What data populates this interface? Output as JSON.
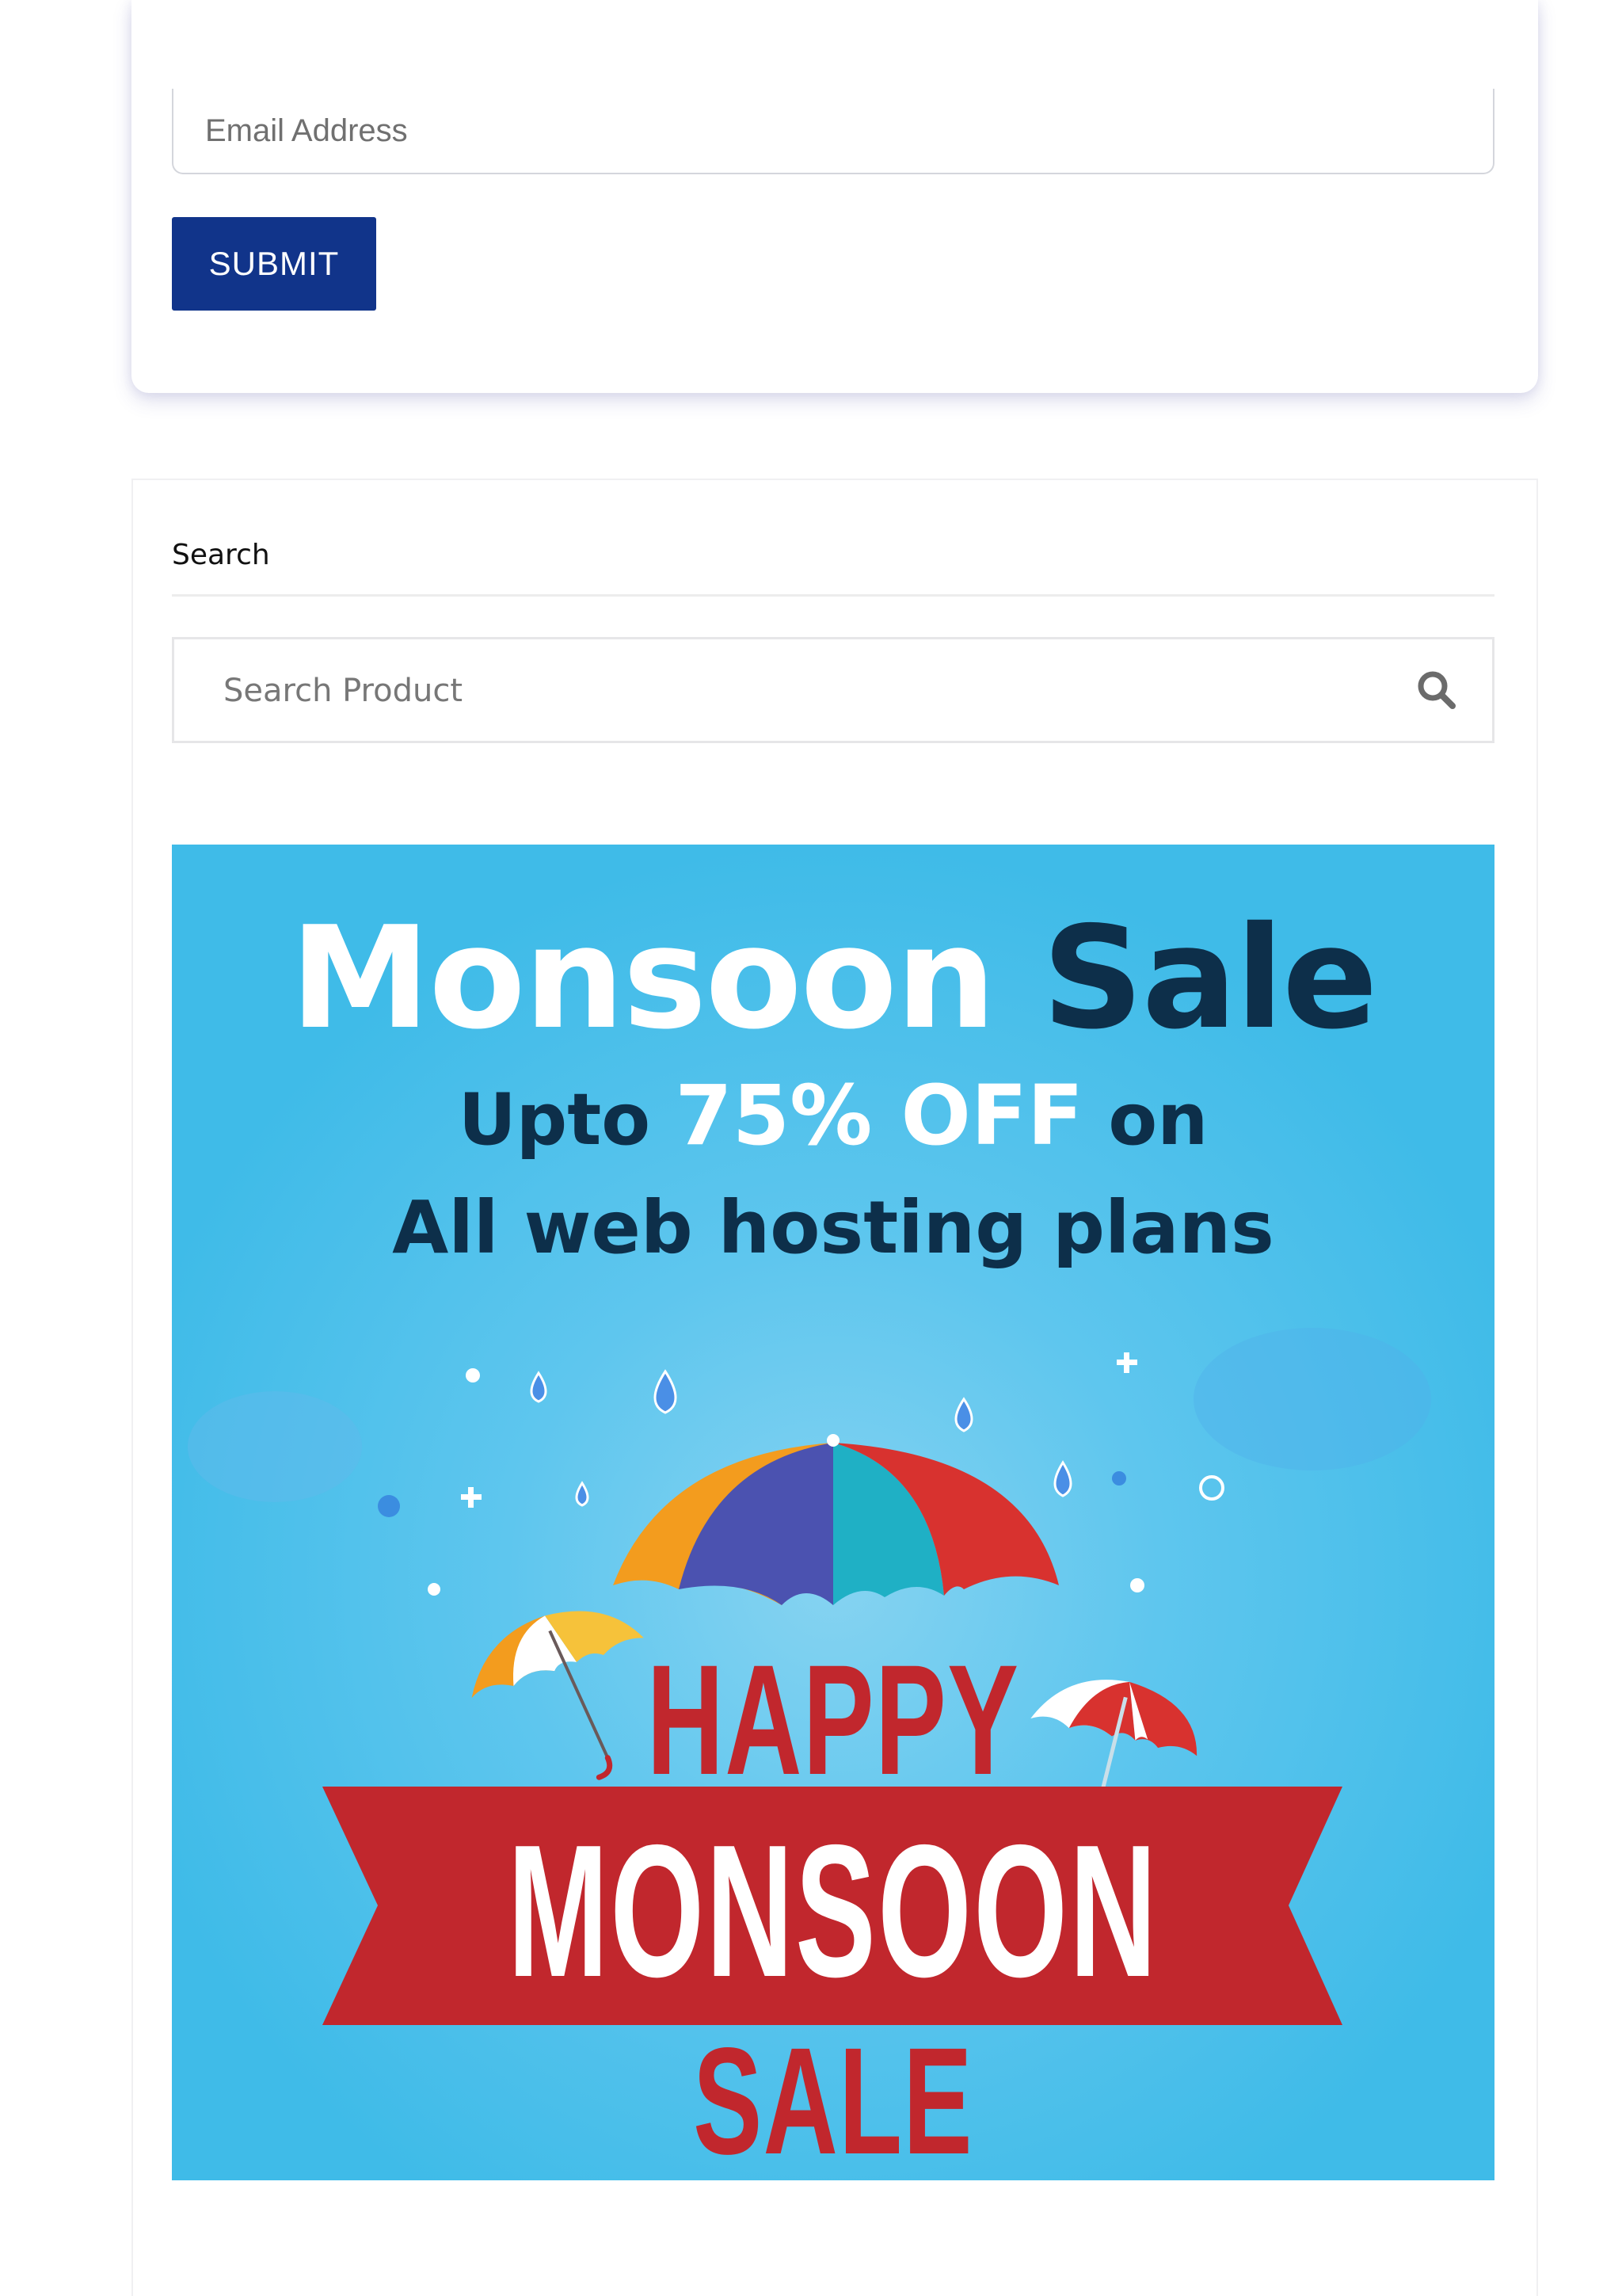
{
  "newsletter": {
    "email_placeholder": "Email Address",
    "submit_label": "SUBMIT"
  },
  "search_widget": {
    "title": "Search",
    "placeholder": "Search Product",
    "icon": "search-icon"
  },
  "banner": {
    "headline_word1": "Monsoon",
    "headline_word2": "Sale",
    "offer_prefix": "Upto",
    "offer_highlight": "75% OFF",
    "offer_suffix": "on",
    "offer_line2": "All web hosting plans",
    "happy_text": "HAPPY",
    "monsoon_text": "MONSOON",
    "sale_text": "SALE",
    "colors": {
      "background": "#3fbbe8",
      "dark_text": "#0d2f4a",
      "ribbon_red": "#c1272d"
    }
  },
  "colors": {
    "submit_button": "#11348a"
  }
}
